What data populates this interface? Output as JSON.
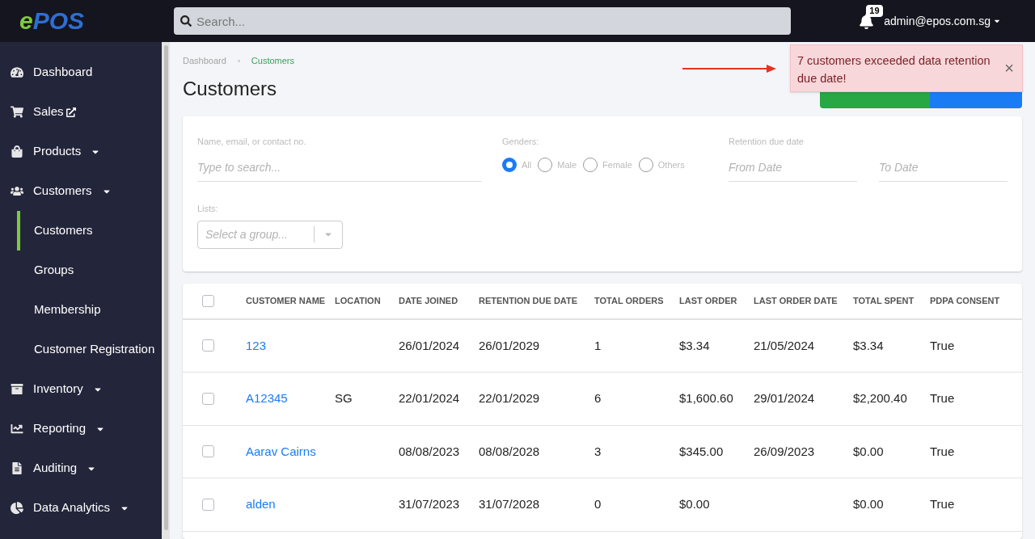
{
  "header": {
    "logo": {
      "letter": "e",
      "rest": "POS"
    },
    "search": {
      "placeholder": "Search..."
    },
    "notifications": "19",
    "user": "admin@epos.com.sg"
  },
  "sidebar": {
    "items": [
      {
        "label": "Dashboard",
        "kind": "link",
        "selected": false
      },
      {
        "label": "Sales",
        "kind": "external",
        "selected": false
      },
      {
        "label": "Products",
        "kind": "menu",
        "selected": false
      },
      {
        "label": "Customers",
        "kind": "menu",
        "selected": false,
        "children": [
          {
            "label": "Customers",
            "selected": true
          },
          {
            "label": "Groups",
            "selected": false
          },
          {
            "label": "Membership",
            "selected": false
          },
          {
            "label": "Customer Registration",
            "selected": false
          }
        ]
      },
      {
        "label": "Inventory",
        "kind": "menu",
        "selected": false
      },
      {
        "label": "Reporting",
        "kind": "menu",
        "selected": false
      },
      {
        "label": "Auditing",
        "kind": "menu",
        "selected": false
      },
      {
        "label": "Data Analytics",
        "kind": "menu",
        "selected": false
      }
    ]
  },
  "breadcrumb": [
    "Dashboard",
    "Customers"
  ],
  "title": "Customers",
  "toast": {
    "message": "7 customers exceeded data retention due date!",
    "close": "×"
  },
  "filters": {
    "name": {
      "label": "Name, email, or contact no.",
      "placeholder": "Type to search..."
    },
    "genders": {
      "label": "Genders:",
      "options": [
        {
          "label": "All",
          "selected": true
        },
        {
          "label": "Male",
          "selected": false
        },
        {
          "label": "Female",
          "selected": false
        },
        {
          "label": "Others",
          "selected": false
        }
      ]
    },
    "retention": {
      "label": "Retention due date",
      "from": {
        "placeholder": "From Date"
      },
      "to": {
        "placeholder": "To Date"
      }
    },
    "lists": {
      "label": "Lists:",
      "placeholder": "Select a group..."
    }
  },
  "table": {
    "columns": [
      "CUSTOMER NAME",
      "LOCATION",
      "DATE JOINED",
      "RETENTION DUE DATE",
      "TOTAL ORDERS",
      "LAST ORDER",
      "LAST ORDER DATE",
      "TOTAL SPENT",
      "PDPA CONSENT"
    ],
    "all_checked": false,
    "rows": [
      {
        "checked": false,
        "cells": [
          "123",
          "",
          "26/01/2024",
          "26/01/2029",
          "1",
          "$3.34",
          "21/05/2024",
          "$3.34",
          "True"
        ]
      },
      {
        "checked": false,
        "cells": [
          "A12345",
          "SG",
          "22/01/2024",
          "22/01/2029",
          "6",
          "$1,600.60",
          "29/01/2024",
          "$2,200.40",
          "True"
        ]
      },
      {
        "checked": false,
        "cells": [
          "Aarav Cairns",
          "",
          "08/08/2023",
          "08/08/2028",
          "3",
          "$345.00",
          "26/09/2023",
          "$0.00",
          "True"
        ]
      },
      {
        "checked": false,
        "cells": [
          "alden",
          "",
          "31/07/2023",
          "31/07/2028",
          "0",
          "$0.00",
          "",
          "$0.00",
          "True"
        ]
      }
    ]
  }
}
